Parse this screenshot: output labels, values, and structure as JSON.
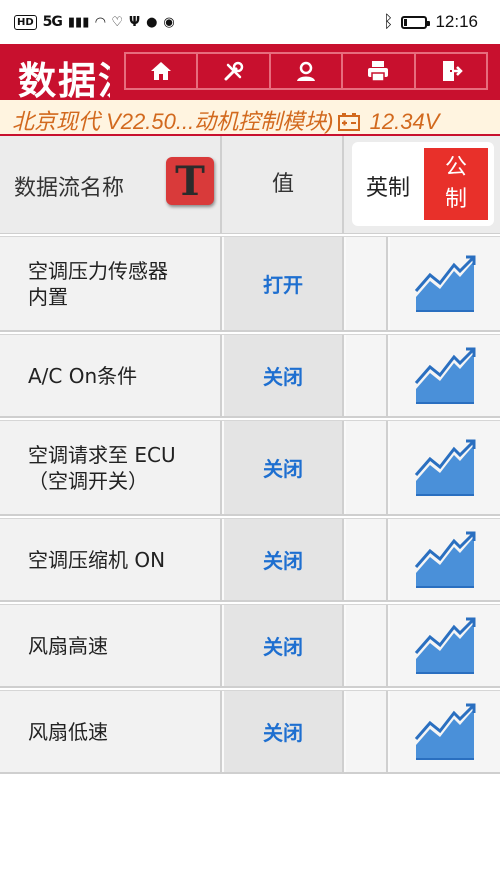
{
  "status_bar": {
    "left_badge": "HD",
    "network": "5G",
    "time": "12:16"
  },
  "header": {
    "title": "数据流",
    "toolbar": [
      {
        "icon": "home-icon"
      },
      {
        "icon": "tools-icon"
      },
      {
        "icon": "user-icon"
      },
      {
        "icon": "printer-icon"
      },
      {
        "icon": "exit-icon"
      }
    ]
  },
  "info_bar": {
    "text_left": "北京现代 V22.50...动机控制模块)",
    "text_right": "12.34V",
    "icon": "battery-icon"
  },
  "table": {
    "col_name": "数据流名称",
    "col_value": "值",
    "t_icon_letter": "T",
    "unit_imperial": "英制",
    "unit_metric": "公\n制",
    "rows": [
      {
        "name": "空调压力传感器\n内置",
        "value": "打开"
      },
      {
        "name": "A/C On条件",
        "value": "关闭"
      },
      {
        "name": "空调请求至 ECU\n（空调开关）",
        "value": "关闭"
      },
      {
        "name": "空调压缩机 ON",
        "value": "关闭"
      },
      {
        "name": "风扇高速",
        "value": "关闭"
      },
      {
        "name": "风扇低速",
        "value": "关闭"
      }
    ]
  },
  "colors": {
    "header_red": "#c8102e",
    "value_blue": "#1e6fd0",
    "info_orange": "#d2691e",
    "graph_blue": "#4a90d9"
  }
}
